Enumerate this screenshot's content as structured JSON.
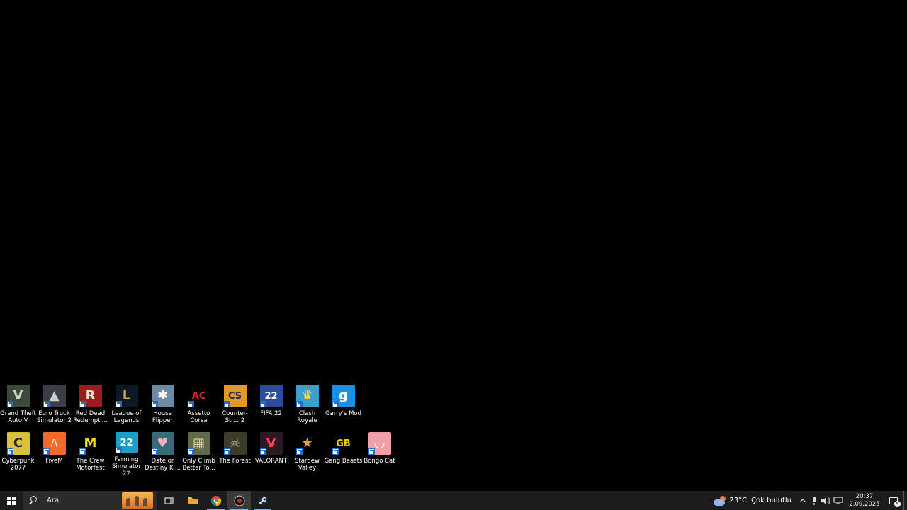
{
  "desktop": {
    "row1": [
      {
        "label": "Grand Theft Auto V",
        "icon": "gta-v-icon",
        "bg": "#3c4a3e",
        "fg": "#c8d7c0",
        "glyph": "V"
      },
      {
        "label": "Euro Truck Simulator 2",
        "icon": "euro-truck-icon",
        "bg": "#3a3f47",
        "fg": "#d0d0d0",
        "glyph": "▲"
      },
      {
        "label": "Red Dead Redempti...",
        "icon": "red-dead-icon",
        "bg": "#9a1d1d",
        "fg": "#f0e0d0",
        "glyph": "R"
      },
      {
        "label": "League of Legends",
        "icon": "league-of-legends-icon",
        "bg": "#0d1a24",
        "fg": "#c9a74e",
        "glyph": "L"
      },
      {
        "label": "House Flipper",
        "icon": "house-flipper-icon",
        "bg": "#6e8aa2",
        "fg": "#ffffff",
        "glyph": "✱"
      },
      {
        "label": "Assetto Corsa",
        "icon": "assetto-corsa-icon",
        "bg": "#000000",
        "fg": "#d42a2a",
        "glyph": "AC"
      },
      {
        "label": "Counter-Str... 2",
        "icon": "counter-strike-icon",
        "bg": "#e19a2a",
        "fg": "#1c2a5a",
        "glyph": "CS"
      },
      {
        "label": "FIFA 22",
        "icon": "fifa-22-icon",
        "bg": "#2a4e9c",
        "fg": "#ffffff",
        "glyph": "22"
      },
      {
        "label": "Clash Royale",
        "icon": "clash-royale-icon",
        "bg": "#3ba1c9",
        "fg": "#ffd23a",
        "glyph": "♛"
      },
      {
        "label": "Garry's Mod",
        "icon": "garrys-mod-icon",
        "bg": "#1e8fe0",
        "fg": "#ffffff",
        "glyph": "g"
      }
    ],
    "row2": [
      {
        "label": "Cyberpunk 2077",
        "icon": "cyberpunk-icon",
        "bg": "#d8c23a",
        "fg": "#2a2a2a",
        "glyph": "C"
      },
      {
        "label": "FiveM",
        "icon": "fivem-icon",
        "bg": "#f26a2a",
        "fg": "#ffffff",
        "glyph": "/\\"
      },
      {
        "label": "The Crew Motorfest",
        "icon": "the-crew-icon",
        "bg": "#000000",
        "fg": "#f0e01a",
        "glyph": "M"
      },
      {
        "label": "Farming Simulator 22",
        "icon": "farming-simulator-icon",
        "bg": "#1aa0c8",
        "fg": "#ffffff",
        "glyph": "22"
      },
      {
        "label": "Date or Destiny Ki...",
        "icon": "date-or-destiny-icon",
        "bg": "#3a6a78",
        "fg": "#f0b0c0",
        "glyph": "♥"
      },
      {
        "label": "Only Climb Better To...",
        "icon": "only-climb-icon",
        "bg": "#5e6a4a",
        "fg": "#e0d8a0",
        "glyph": "▦"
      },
      {
        "label": "The Forest",
        "icon": "the-forest-icon",
        "bg": "#3c3a2a",
        "fg": "#a0a080",
        "glyph": "☠"
      },
      {
        "label": "VALORANT",
        "icon": "valorant-icon",
        "bg": "#2a1a24",
        "fg": "#ff4655",
        "glyph": "V"
      },
      {
        "label": "Stardew Valley",
        "icon": "stardew-valley-icon",
        "bg": "#000000",
        "fg": "#f0a030",
        "glyph": "★"
      },
      {
        "label": "Gang Beasts",
        "icon": "gang-beasts-icon",
        "bg": "#000000",
        "fg": "#f0d01a",
        "glyph": "GB"
      },
      {
        "label": "Bongo Cat",
        "icon": "bongo-cat-icon",
        "bg": "#f0a0a8",
        "fg": "#ffffff",
        "glyph": "◡"
      }
    ]
  },
  "taskbar": {
    "search_placeholder": "Ara",
    "weather_temp": "23°C",
    "weather_condition": "Çok bulutlu",
    "time": "20:37",
    "date": "2.09.2025",
    "notification_count": "4",
    "accent": "#7fb3f0"
  }
}
